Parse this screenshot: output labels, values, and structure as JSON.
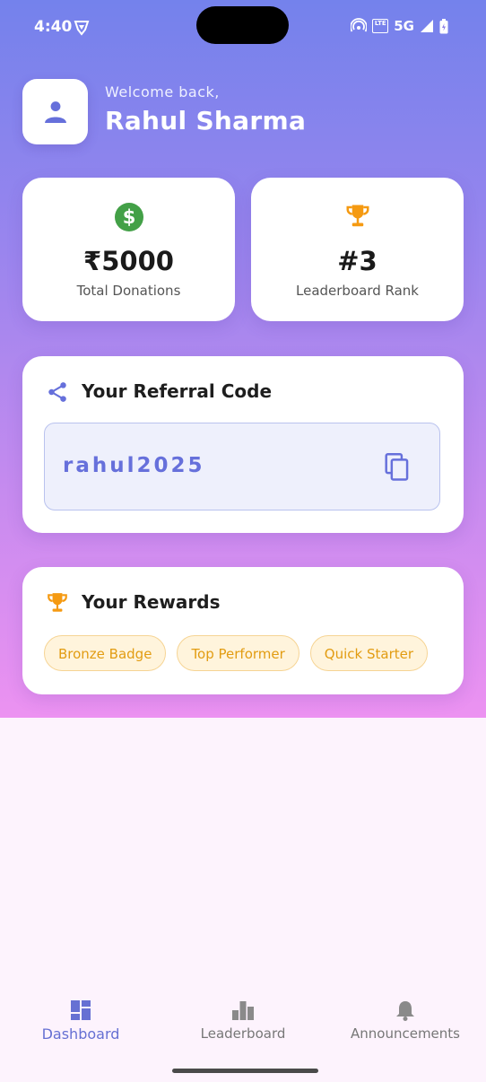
{
  "status_bar": {
    "time": "4:40",
    "network": "5G",
    "lte": "LTE"
  },
  "header": {
    "welcome": "Welcome back,",
    "user_name": "Rahul Sharma"
  },
  "stats": [
    {
      "value": "₹5000",
      "label": "Total Donations",
      "icon": "dollar-circle-icon"
    },
    {
      "value": "#3",
      "label": "Leaderboard Rank",
      "icon": "trophy-icon"
    }
  ],
  "referral": {
    "title": "Your Referral Code",
    "code": "rahul2025"
  },
  "rewards": {
    "title": "Your Rewards",
    "badges": [
      "Bronze Badge",
      "Top Performer",
      "Quick Starter"
    ]
  },
  "nav": [
    {
      "label": "Dashboard",
      "active": true
    },
    {
      "label": "Leaderboard",
      "active": false
    },
    {
      "label": "Announcements",
      "active": false
    }
  ],
  "colors": {
    "accent": "#6670db",
    "reward": "#e29c12",
    "money": "#43a047",
    "gradient_top": "#7482ec",
    "gradient_bottom": "#ec92f1"
  }
}
